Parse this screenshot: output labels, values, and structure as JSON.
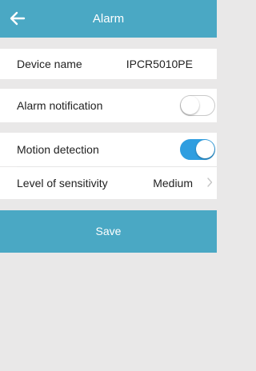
{
  "header": {
    "title": "Alarm",
    "back_icon": "arrow-left-icon"
  },
  "device": {
    "label": "Device name",
    "value": "IPCR5010PE"
  },
  "alarm_notification": {
    "label": "Alarm notification",
    "enabled": false
  },
  "motion_detection": {
    "label": "Motion detection",
    "enabled": true
  },
  "sensitivity": {
    "label": "Level of sensitivity",
    "value": "Medium",
    "chevron_icon": "chevron-right-icon"
  },
  "save": {
    "label": "Save"
  },
  "colors": {
    "accent": "#4aa8c4",
    "toggle_on": "#2f9ee0",
    "background": "#e9e8e8"
  }
}
